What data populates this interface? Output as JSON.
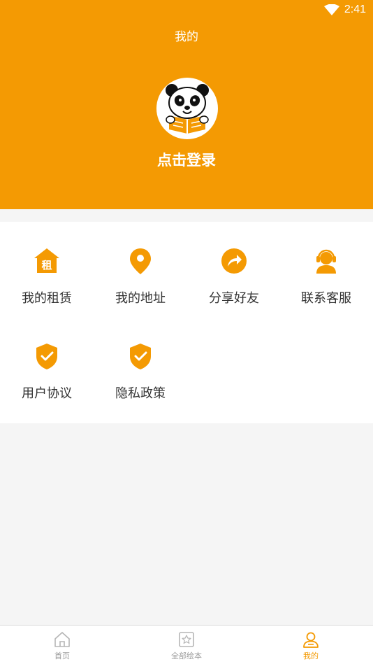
{
  "status_bar": {
    "time": "2:41"
  },
  "header": {
    "title": "我的",
    "login_label": "点击登录"
  },
  "menu": {
    "items": [
      {
        "label": "我的租赁",
        "icon": "house-rent-icon",
        "glyph": "租"
      },
      {
        "label": "我的地址",
        "icon": "location-pin-icon"
      },
      {
        "label": "分享好友",
        "icon": "share-icon"
      },
      {
        "label": "联系客服",
        "icon": "customer-service-icon"
      },
      {
        "label": "用户协议",
        "icon": "shield-check-icon"
      },
      {
        "label": "隐私政策",
        "icon": "shield-check-icon"
      }
    ]
  },
  "tabbar": {
    "tabs": [
      {
        "label": "首页",
        "icon": "home-icon",
        "active": false
      },
      {
        "label": "全部绘本",
        "icon": "book-star-icon",
        "active": false
      },
      {
        "label": "我的",
        "icon": "person-icon",
        "active": true
      }
    ]
  },
  "colors": {
    "accent": "#f49a03",
    "background": "#f5f5f5",
    "text": "#333333",
    "inactive": "#9a9a9a"
  }
}
